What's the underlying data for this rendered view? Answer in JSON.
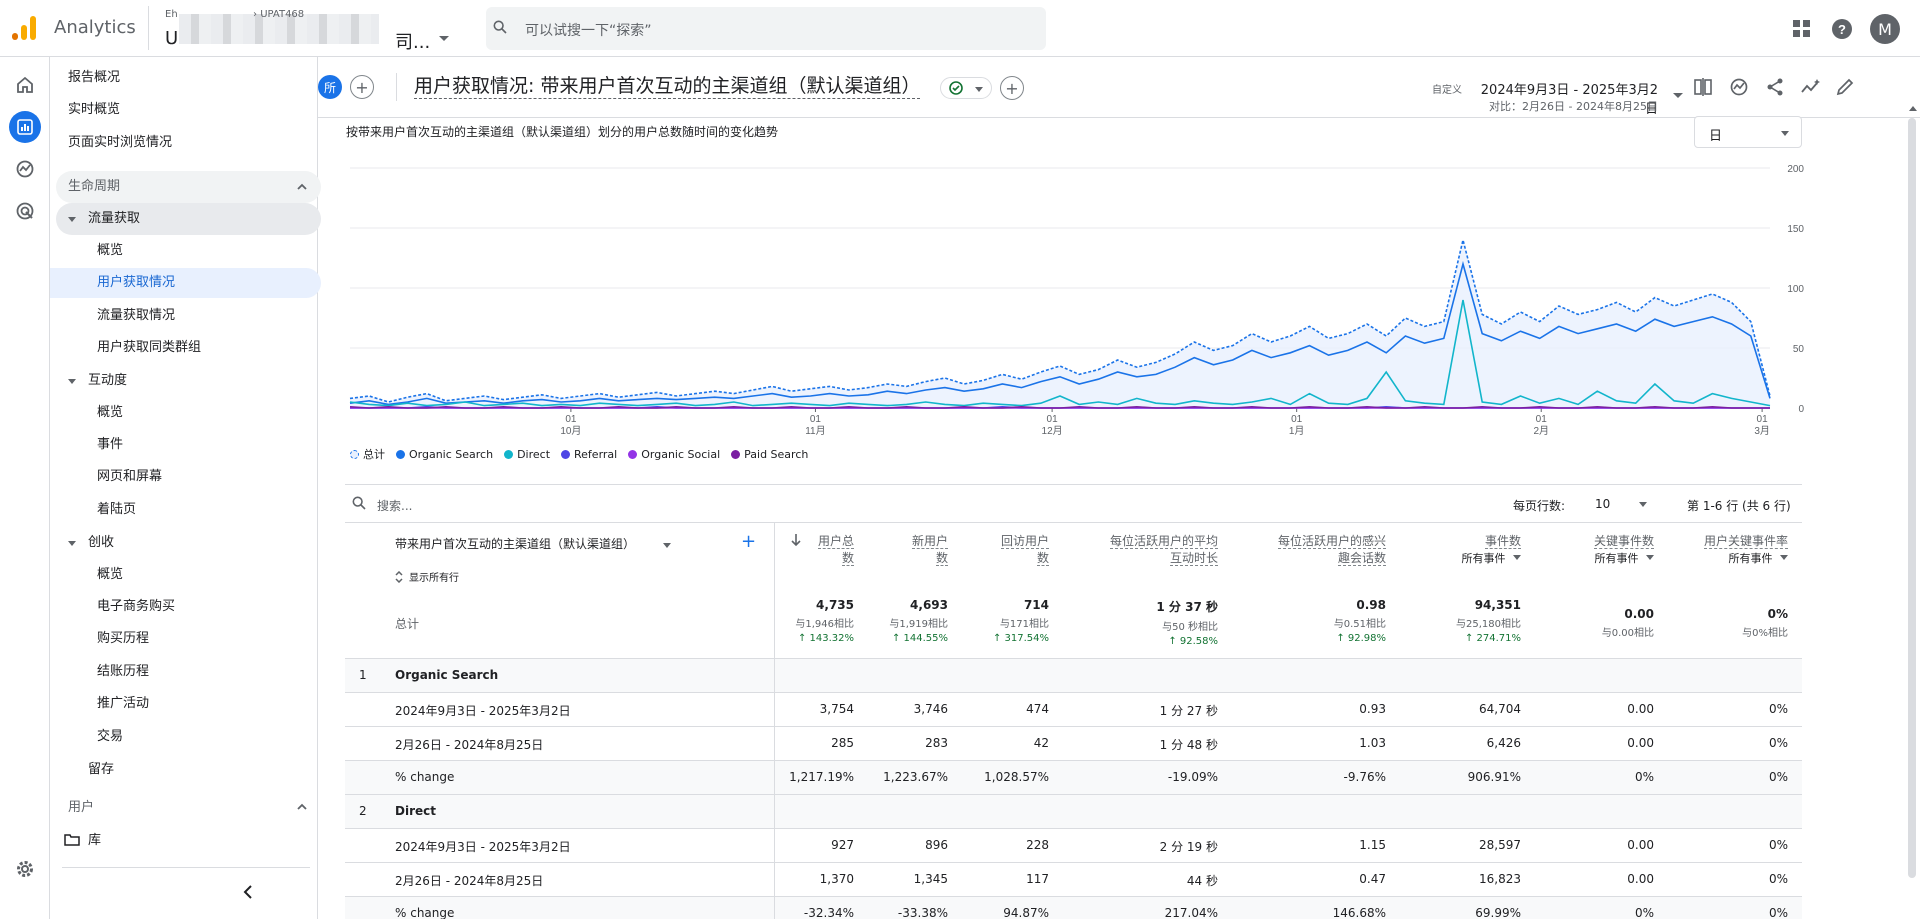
{
  "topbar": {
    "app_name": "Analytics",
    "account_small": "Eh",
    "account_code": "UPAT468",
    "account_big_prefix": "U",
    "account_big_suffix": "司...",
    "search_placeholder": "可以试搜一下“探索”",
    "avatar_letter": "M"
  },
  "colors": {
    "accent": "#1a73e8",
    "logo_orange": "#f9ab00",
    "logo_dark": "#e37400",
    "total": "#1a73e8",
    "organic_search": "#1a73e8",
    "direct": "#12b5cb",
    "referral": "#4f46e5",
    "organic_social": "#9334e6",
    "paid_search": "#7b1fa2",
    "positive": "#137333"
  },
  "sidebar": {
    "top_items": [
      "报告概况",
      "实时概览",
      "页面实时浏览情况"
    ],
    "section_lifecycle": "生命周期",
    "groups": {
      "acquisition": "流量获取",
      "engagement": "互动度",
      "monetization": "创收",
      "retention": "留存"
    },
    "acquisition_items": [
      "概览",
      "用户获取情况",
      "流量获取情况",
      "用户获取同类群组"
    ],
    "engagement_items": [
      "概览",
      "事件",
      "网页和屏幕",
      "着陆页"
    ],
    "monetization_items": [
      "概览",
      "电子商务购买",
      "购买历程",
      "结账历程",
      "推广活动",
      "交易"
    ],
    "section_user": "用户",
    "library": "库"
  },
  "header": {
    "all_chip": "所",
    "title": "用户获取情况: 带来用户首次互动的主渠道组（默认渠道组）",
    "date_label": "自定义",
    "date_range": "2024年9月3日 - 2025年3月2日",
    "compare_range": "对比：2月26日 - 2024年8月25日"
  },
  "chart": {
    "description": "按带来用户首次互动的主渠道组（默认渠道组）划分的用户总数随时间的变化趋势",
    "granularity": "日"
  },
  "chart_data": {
    "type": "line",
    "y_ticks": [
      "200",
      "150",
      "100",
      "50",
      "0"
    ],
    "ylim": [
      0,
      200
    ],
    "x_ticks": [
      {
        "day": "01",
        "month": "10月"
      },
      {
        "day": "01",
        "month": "11月"
      },
      {
        "day": "01",
        "month": "12月"
      },
      {
        "day": "01",
        "month": "1月"
      },
      {
        "day": "01",
        "month": "2月"
      },
      {
        "day": "01",
        "month": "3月"
      }
    ],
    "x_start": "2024-09-03",
    "x_end": "2025-03-02",
    "series": [
      {
        "name": "总计",
        "style": "dashed",
        "values": [
          8,
          10,
          5,
          9,
          12,
          6,
          8,
          10,
          7,
          9,
          11,
          8,
          10,
          12,
          9,
          11,
          13,
          10,
          12,
          14,
          12,
          15,
          18,
          14,
          16,
          18,
          15,
          17,
          20,
          18,
          22,
          25,
          20,
          23,
          28,
          24,
          30,
          35,
          28,
          32,
          40,
          34,
          38,
          45,
          55,
          48,
          52,
          62,
          55,
          60,
          68,
          58,
          62,
          70,
          60,
          75,
          68,
          72,
          140,
          78,
          70,
          80,
          72,
          85,
          78,
          82,
          88,
          80,
          92,
          85,
          90,
          95,
          88,
          72,
          10
        ]
      },
      {
        "name": "Organic Search",
        "style": "solid",
        "values": [
          4,
          6,
          3,
          5,
          8,
          4,
          5,
          6,
          4,
          6,
          7,
          5,
          6,
          8,
          6,
          7,
          8,
          7,
          8,
          9,
          8,
          10,
          12,
          9,
          10,
          12,
          10,
          11,
          14,
          12,
          15,
          17,
          14,
          16,
          20,
          17,
          22,
          26,
          20,
          24,
          30,
          26,
          28,
          34,
          42,
          36,
          40,
          48,
          42,
          46,
          52,
          44,
          48,
          55,
          46,
          60,
          54,
          58,
          120,
          62,
          56,
          64,
          58,
          68,
          62,
          66,
          70,
          64,
          74,
          68,
          72,
          76,
          70,
          60,
          8
        ]
      },
      {
        "name": "Direct",
        "style": "solid",
        "values": [
          5,
          3,
          2,
          4,
          2,
          3,
          5,
          2,
          3,
          4,
          2,
          3,
          2,
          4,
          3,
          2,
          3,
          4,
          2,
          3,
          5,
          2,
          3,
          4,
          3,
          2,
          4,
          3,
          2,
          3,
          5,
          3,
          2,
          4,
          3,
          2,
          4,
          10,
          3,
          5,
          3,
          8,
          4,
          3,
          6,
          4,
          3,
          5,
          8,
          3,
          12,
          4,
          3,
          8,
          30,
          6,
          4,
          3,
          90,
          5,
          3,
          10,
          4,
          8,
          3,
          14,
          6,
          4,
          20,
          6,
          4,
          12,
          8,
          5,
          2
        ]
      },
      {
        "name": "Referral",
        "style": "solid",
        "values": [
          0,
          0,
          0,
          0,
          1,
          0,
          0,
          0,
          0,
          0,
          0,
          0,
          0,
          0,
          0,
          0,
          1,
          0,
          0,
          0,
          0,
          0,
          0,
          0,
          0,
          0,
          0,
          0,
          0,
          0,
          0,
          0,
          0,
          0,
          1,
          0,
          0,
          0,
          0,
          0,
          0,
          0,
          0,
          0,
          0,
          0,
          0,
          0,
          0,
          0,
          0,
          0,
          0,
          0,
          1,
          0,
          0,
          0,
          0,
          0,
          0,
          0,
          0,
          0,
          0,
          0,
          0,
          0,
          0,
          0,
          0,
          0,
          0,
          0,
          0
        ]
      },
      {
        "name": "Organic Social",
        "style": "solid",
        "values": [
          0,
          0,
          0,
          0,
          0,
          0,
          0,
          0,
          0,
          0,
          0,
          0,
          0,
          0,
          0,
          0,
          0,
          0,
          0,
          0,
          0,
          0,
          0,
          0,
          0,
          0,
          0,
          0,
          0,
          0,
          0,
          0,
          0,
          0,
          0,
          0,
          0,
          0,
          0,
          0,
          0,
          0,
          0,
          0,
          0,
          0,
          0,
          0,
          0,
          0,
          0,
          0,
          0,
          0,
          0,
          0,
          0,
          0,
          0,
          0,
          0,
          0,
          0,
          0,
          0,
          0,
          0,
          0,
          0,
          0,
          0,
          0,
          0,
          0,
          0
        ]
      },
      {
        "name": "Paid Search",
        "style": "solid",
        "values": [
          1,
          0,
          1,
          0,
          0,
          1,
          0,
          0,
          1,
          0,
          0,
          1,
          0,
          0,
          1,
          0,
          0,
          1,
          0,
          0,
          1,
          0,
          0,
          1,
          0,
          0,
          1,
          0,
          0,
          1,
          0,
          0,
          1,
          0,
          0,
          1,
          0,
          0,
          1,
          0,
          0,
          1,
          0,
          0,
          1,
          0,
          0,
          1,
          0,
          0,
          1,
          0,
          0,
          1,
          0,
          0,
          1,
          0,
          0,
          1,
          0,
          0,
          1,
          0,
          0,
          1,
          0,
          0,
          1,
          0,
          0,
          1,
          0,
          0,
          0
        ]
      }
    ],
    "legend_position": "bottom-left"
  },
  "table": {
    "search_placeholder": "搜索...",
    "rows_per_page_label": "每页行数:",
    "rows_per_page": "10",
    "page_info": "第 1-6 行 (共 6 行)",
    "dimension_header": "带来用户首次互动的主渠道组（默认渠道组）",
    "show_all_rows": "显示所有行",
    "total_label": "总计",
    "columns": [
      {
        "l1": "用户总",
        "l2": "数",
        "sub": ""
      },
      {
        "l1": "新用户",
        "l2": "数",
        "sub": ""
      },
      {
        "l1": "回访用户",
        "l2": "数",
        "sub": ""
      },
      {
        "l1": "每位活跃用户的平均",
        "l2": "互动时长",
        "sub": ""
      },
      {
        "l1": "每位活跃用户的感兴",
        "l2": "趣会话数",
        "sub": ""
      },
      {
        "l1": "事件数",
        "l2": "",
        "sub": "所有事件"
      },
      {
        "l1": "关键事件数",
        "l2": "",
        "sub": "所有事件"
      },
      {
        "l1": "用户关键事件率",
        "l2": "",
        "sub": "所有事件"
      }
    ],
    "totals": [
      {
        "v": "4,735",
        "c1": "与1,946相比",
        "c2": "↑ 143.32%"
      },
      {
        "v": "4,693",
        "c1": "与1,919相比",
        "c2": "↑ 144.55%"
      },
      {
        "v": "714",
        "c1": "与171相比",
        "c2": "↑ 317.54%"
      },
      {
        "v": "1 分 37 秒",
        "c1": "与50 秒相比",
        "c2": "↑ 92.58%"
      },
      {
        "v": "0.98",
        "c1": "与0.51相比",
        "c2": "↑ 92.98%"
      },
      {
        "v": "94,351",
        "c1": "与25,180相比",
        "c2": "↑ 274.71%"
      },
      {
        "v": "0.00",
        "c1": "与0.00相比",
        "c2": ""
      },
      {
        "v": "0%",
        "c1": "与0%相比",
        "c2": ""
      }
    ],
    "groups": [
      {
        "idx": "1",
        "name": "Organic Search",
        "rows": [
          {
            "label": "2024年9月3日 - 2025年3月2日",
            "cells": [
              "3,754",
              "3,746",
              "474",
              "1 分 27 秒",
              "0.93",
              "64,704",
              "0.00",
              "0%"
            ]
          },
          {
            "label": "2月26日 - 2024年8月25日",
            "cells": [
              "285",
              "283",
              "42",
              "1 分 48 秒",
              "1.03",
              "6,426",
              "0.00",
              "0%"
            ]
          },
          {
            "label": "% change",
            "cells": [
              "1,217.19%",
              "1,223.67%",
              "1,028.57%",
              "-19.09%",
              "-9.76%",
              "906.91%",
              "0%",
              "0%"
            ]
          }
        ]
      },
      {
        "idx": "2",
        "name": "Direct",
        "rows": [
          {
            "label": "2024年9月3日 - 2025年3月2日",
            "cells": [
              "927",
              "896",
              "228",
              "2 分 19 秒",
              "1.15",
              "28,597",
              "0.00",
              "0%"
            ]
          },
          {
            "label": "2月26日 - 2024年8月25日",
            "cells": [
              "1,370",
              "1,345",
              "117",
              "44 秒",
              "0.47",
              "16,823",
              "0.00",
              "0%"
            ]
          },
          {
            "label": "% change",
            "cells": [
              "-32.34%",
              "-33.38%",
              "94.87%",
              "217.04%",
              "146.68%",
              "69.99%",
              "0%",
              "0%"
            ]
          }
        ]
      }
    ]
  }
}
